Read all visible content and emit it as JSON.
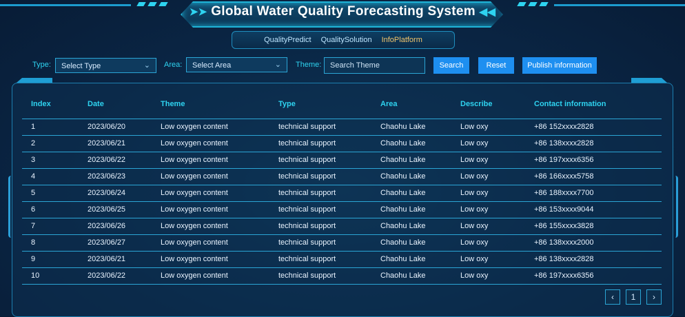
{
  "header": {
    "title": "Global Water Quality Forecasting System"
  },
  "nav": {
    "tabs": [
      {
        "label": "QualityPredict",
        "active": false
      },
      {
        "label": "QualitySolution",
        "active": false
      },
      {
        "label": "InfoPlatform",
        "active": true
      }
    ]
  },
  "filters": {
    "type_label": "Type:",
    "type_value": "Select Type",
    "area_label": "Area:",
    "area_value": "Select Area",
    "theme_label": "Theme:",
    "theme_placeholder": "Search Theme",
    "search_button": "Search",
    "reset_button": "Reset",
    "publish_button": "Publish information"
  },
  "table": {
    "columns": [
      "Index",
      "Date",
      "Theme",
      "Type",
      "Area",
      "Describe",
      "Contact information"
    ],
    "rows": [
      [
        "1",
        "2023/06/20",
        "Low oxygen content",
        "technical support",
        "Chaohu Lake",
        "Low oxy",
        "+86 152xxxx2828"
      ],
      [
        "2",
        "2023/06/21",
        "Low oxygen content",
        "technical support",
        "Chaohu Lake",
        "Low oxy",
        "+86 138xxxx2828"
      ],
      [
        "3",
        "2023/06/22",
        "Low oxygen content",
        "technical support",
        "Chaohu Lake",
        "Low oxy",
        "+86 197xxxx6356"
      ],
      [
        "4",
        "2023/06/23",
        "Low oxygen content",
        "technical support",
        "Chaohu Lake",
        "Low oxy",
        "+86 166xxxx5758"
      ],
      [
        "5",
        "2023/06/24",
        "Low oxygen content",
        "technical support",
        "Chaohu Lake",
        "Low oxy",
        "+86 188xxxx7700"
      ],
      [
        "6",
        "2023/06/25",
        "Low oxygen content",
        "technical support",
        "Chaohu Lake",
        "Low oxy",
        "+86 153xxxx9044"
      ],
      [
        "7",
        "2023/06/26",
        "Low oxygen content",
        "technical support",
        "Chaohu Lake",
        "Low oxy",
        "+86 155xxxx3828"
      ],
      [
        "8",
        "2023/06/27",
        "Low oxygen content",
        "technical support",
        "Chaohu Lake",
        "Low oxy",
        "+86 138xxxx2000"
      ],
      [
        "9",
        "2023/06/21",
        "Low oxygen content",
        "technical support",
        "Chaohu Lake",
        "Low oxy",
        "+86 138xxxx2828"
      ],
      [
        "10",
        "2023/06/22",
        "Low oxygen content",
        "technical support",
        "Chaohu Lake",
        "Low oxy",
        "+86 197xxxx6356"
      ]
    ]
  },
  "pagination": {
    "prev_icon": "chevron-left-icon",
    "current_page": "1",
    "next_icon": "chevron-right-icon"
  }
}
